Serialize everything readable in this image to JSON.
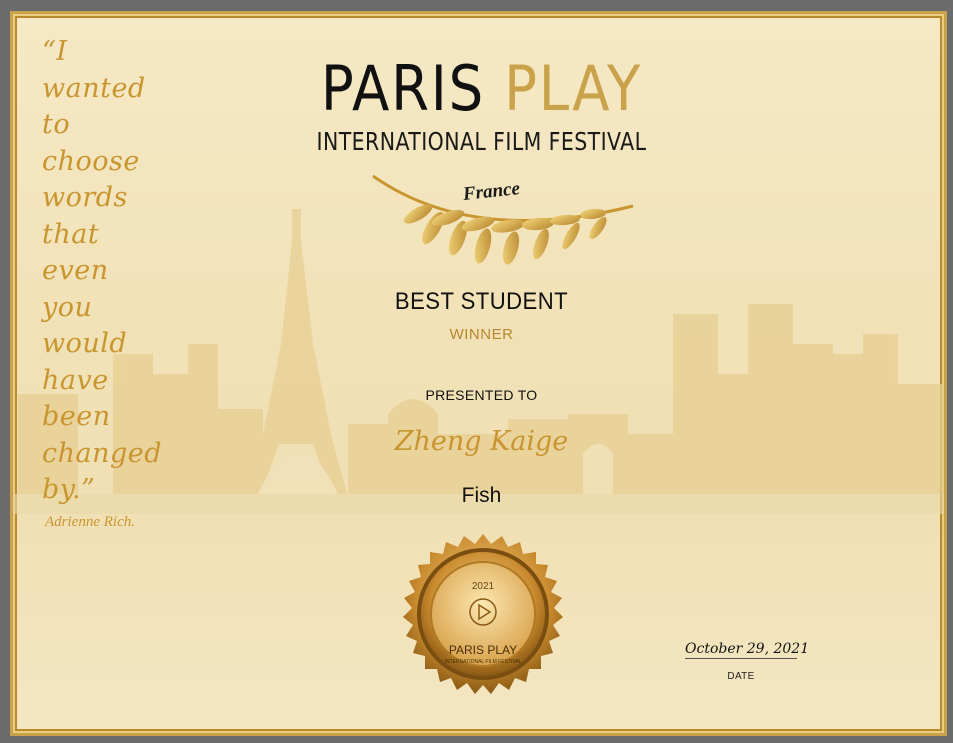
{
  "certificate": {
    "title_word1": "PARIS",
    "title_word2": "PLAY",
    "subtitle": "INTERNATIONAL FILM FESTIVAL",
    "country": "France",
    "award": "BEST STUDENT",
    "award_status": "WINNER",
    "presented_label": "PRESENTED TO",
    "recipient": "Zheng Kaige",
    "film_title": "Fish",
    "date_value": "October 29, 2021",
    "date_label": "DATE"
  },
  "quote": {
    "lines": [
      "“I",
      "wanted",
      "to",
      "choose",
      "words",
      "that",
      "even",
      "you",
      "would",
      "have",
      "been",
      "changed",
      "by.”"
    ],
    "author": "Adrienne Rich."
  },
  "seal": {
    "year": "2021",
    "name": "PARIS PLAY",
    "subtitle": "INTERNATIONAL FILM FESTIVAL",
    "icon": "play-icon"
  },
  "colors": {
    "gold": "#c9a24a",
    "dark_gold": "#b8862d",
    "paper": "#f2e4bd",
    "frame": "#6b6b6b"
  }
}
